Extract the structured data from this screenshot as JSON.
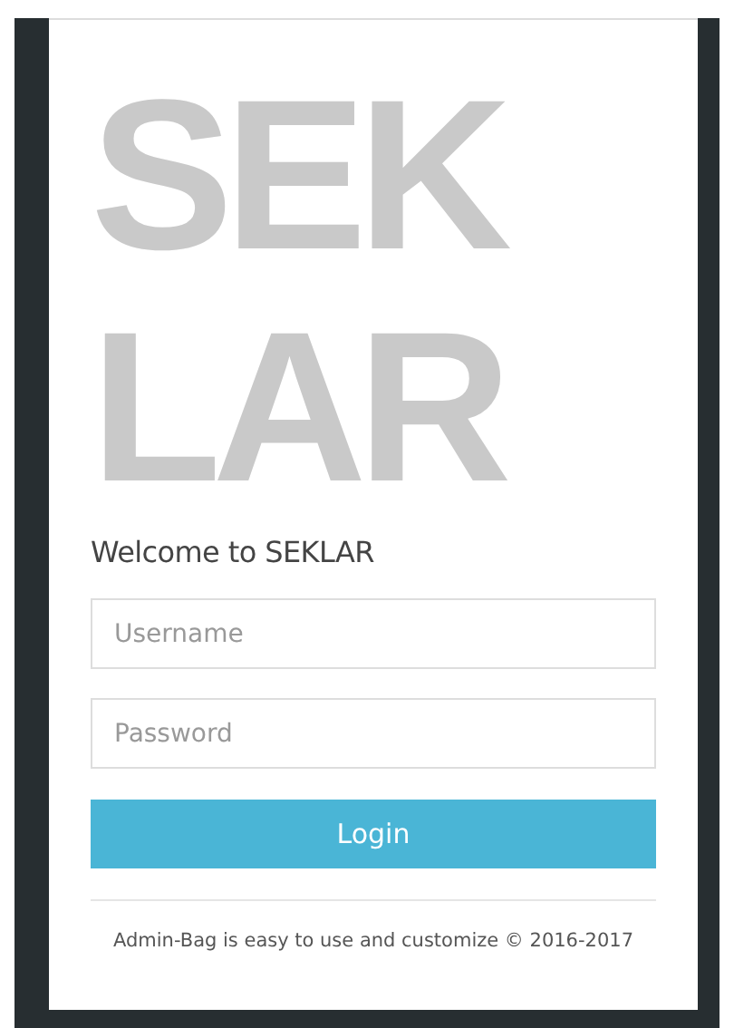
{
  "logo": {
    "lines": [
      "SEK",
      "LAR"
    ]
  },
  "heading": "Welcome to SEKLAR",
  "fields": [
    {
      "placeholder": "Username"
    },
    {
      "placeholder": "Password"
    }
  ],
  "login_button": "Login",
  "footer": "Admin-Bag is easy to use and customize © 2016-2017"
}
